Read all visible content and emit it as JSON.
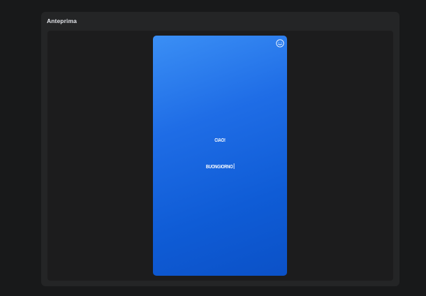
{
  "preview": {
    "title": "Anteprima",
    "story": {
      "background_gradient": [
        "#3b8ff5",
        "#0b51c7"
      ],
      "text_line_1": "CIAO!",
      "text_line_2": "BUONGIORNO"
    },
    "emoji_button_icon": "smiley-icon"
  }
}
